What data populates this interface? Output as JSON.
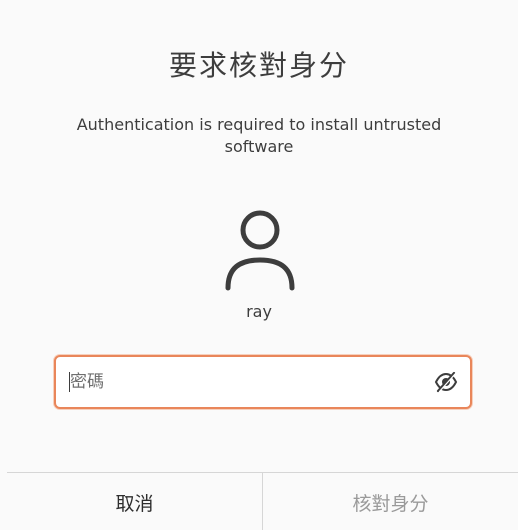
{
  "dialog": {
    "title": "要求核對身分",
    "message": "Authentication is required to install untrusted software",
    "user": {
      "name": "ray",
      "avatar_icon": "user-avatar-icon"
    },
    "password": {
      "placeholder": "密碼",
      "value": "",
      "toggle_icon": "eye-hidden-icon"
    },
    "buttons": {
      "cancel_label": "取消",
      "authenticate_label": "核對身分"
    }
  },
  "colors": {
    "focus_border": "#e9865a",
    "text": "#3d3d3d",
    "disabled_text": "#9a9a9a"
  }
}
